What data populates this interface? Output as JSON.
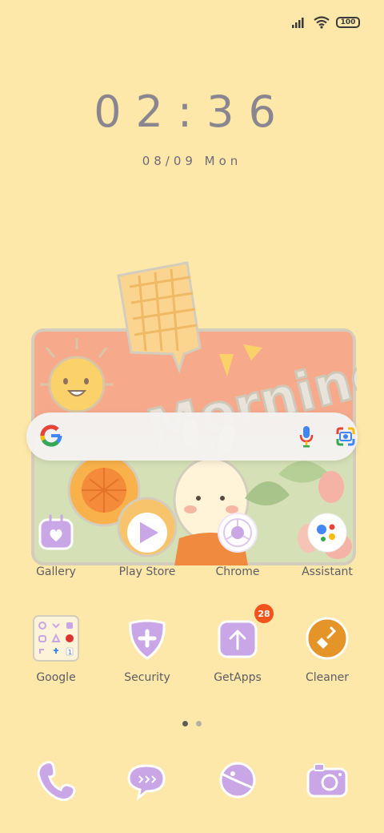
{
  "status": {
    "battery": "100"
  },
  "clock": {
    "time": "02:36",
    "date": "08/09 Mon"
  },
  "widget": {
    "word": "Morning"
  },
  "row1": [
    {
      "label": "Gallery"
    },
    {
      "label": "Play Store"
    },
    {
      "label": "Chrome"
    },
    {
      "label": "Assistant"
    }
  ],
  "row2": [
    {
      "label": "Google"
    },
    {
      "label": "Security"
    },
    {
      "label": "GetApps",
      "badge": "28"
    },
    {
      "label": "Cleaner"
    }
  ],
  "colors": {
    "background": "#fde8a9",
    "icon_purple": "#c9a6e6",
    "badge": "#f2541b",
    "cleaner": "#e59428"
  }
}
